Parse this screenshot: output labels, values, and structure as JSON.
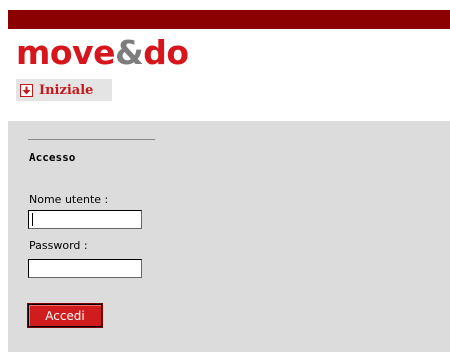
{
  "header": {
    "logo": {
      "part1": "move",
      "amp": "&",
      "part2": "do"
    },
    "nav": {
      "label": "Iniziale",
      "icon": "down-arrow-icon"
    }
  },
  "login": {
    "section_title": "Accesso",
    "username_label": "Nome utente :",
    "username_value": "",
    "password_label": "Password :",
    "password_value": "",
    "submit_label": "Accedi"
  },
  "colors": {
    "top_bar": "#8b0000",
    "logo_red": "#d6161c",
    "logo_grey": "#7d7d7d",
    "panel_bg": "#dcdcdc",
    "button_bg": "#d01c1c"
  }
}
